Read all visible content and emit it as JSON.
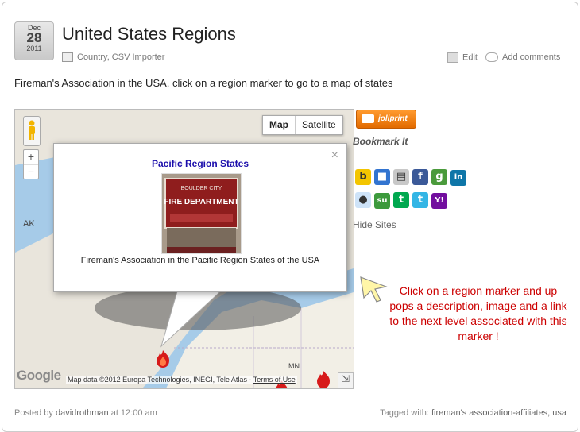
{
  "post": {
    "date": {
      "month": "Dec",
      "day": "28",
      "year": "2011"
    },
    "title": "United States Regions",
    "categories": "Country, CSV Importer",
    "edit_label": "Edit",
    "comments_label": "Add comments",
    "intro": "Fireman's Association in the USA, click on a region marker to go to a map of states"
  },
  "map": {
    "map_button": "Map",
    "satellite_button": "Satellite",
    "zoom_in": "+",
    "zoom_out": "−",
    "credit_prefix": "Map data ©2012 Europa Technologies, INEGI, Tele Atlas - ",
    "credit_terms": "Terms of Use",
    "logo": "Google",
    "labels": {
      "ak": "AK",
      "mn": "MN"
    },
    "infowindow": {
      "title": "Pacific Region States",
      "image_sign_line1": "BOULDER CITY",
      "image_sign_line2": "FIRE DEPARTMENT",
      "description": "Fireman's Association in the Pacific Region States of the USA",
      "close": "×"
    }
  },
  "sidebar": {
    "joliprint": "joliprint",
    "bookmark_title": "Bookmark It",
    "hide_sites": "Hide Sites",
    "social": [
      {
        "name": "bebo",
        "glyph": "b",
        "color": "#f3c500"
      },
      {
        "name": "delicious",
        "glyph": "■",
        "color": "#3274d0"
      },
      {
        "name": "digg",
        "glyph": "▤",
        "color": "#c8c8c8"
      },
      {
        "name": "facebook",
        "glyph": "f",
        "color": "#3b5998"
      },
      {
        "name": "google",
        "glyph": "g",
        "color": "#4a9a3b"
      },
      {
        "name": "linkedin",
        "glyph": "in",
        "color": "#0e76a8"
      },
      {
        "name": "reddit",
        "glyph": "●",
        "color": "#cee3f8"
      },
      {
        "name": "stumbleupon",
        "glyph": "su",
        "color": "#3d9a3d"
      },
      {
        "name": "technorati",
        "glyph": "t",
        "color": "#00a84f"
      },
      {
        "name": "twitter",
        "glyph": "t",
        "color": "#33b5e5"
      },
      {
        "name": "yahoo",
        "glyph": "Y!",
        "color": "#720e9e"
      }
    ]
  },
  "callout": {
    "text": "Click on a region marker and up pops a description, image and a link to the next level associated with this marker !"
  },
  "footer": {
    "posted_by": "Posted by",
    "author": "davidrothman",
    "at_time": "at 12:00 am",
    "tagged_with": "Tagged with:",
    "tags": "fireman's association-affiliates, usa"
  },
  "colors": {
    "accent_link": "#1a0dab",
    "callout_red": "#cc0000",
    "marker_red": "#d71a1a"
  }
}
